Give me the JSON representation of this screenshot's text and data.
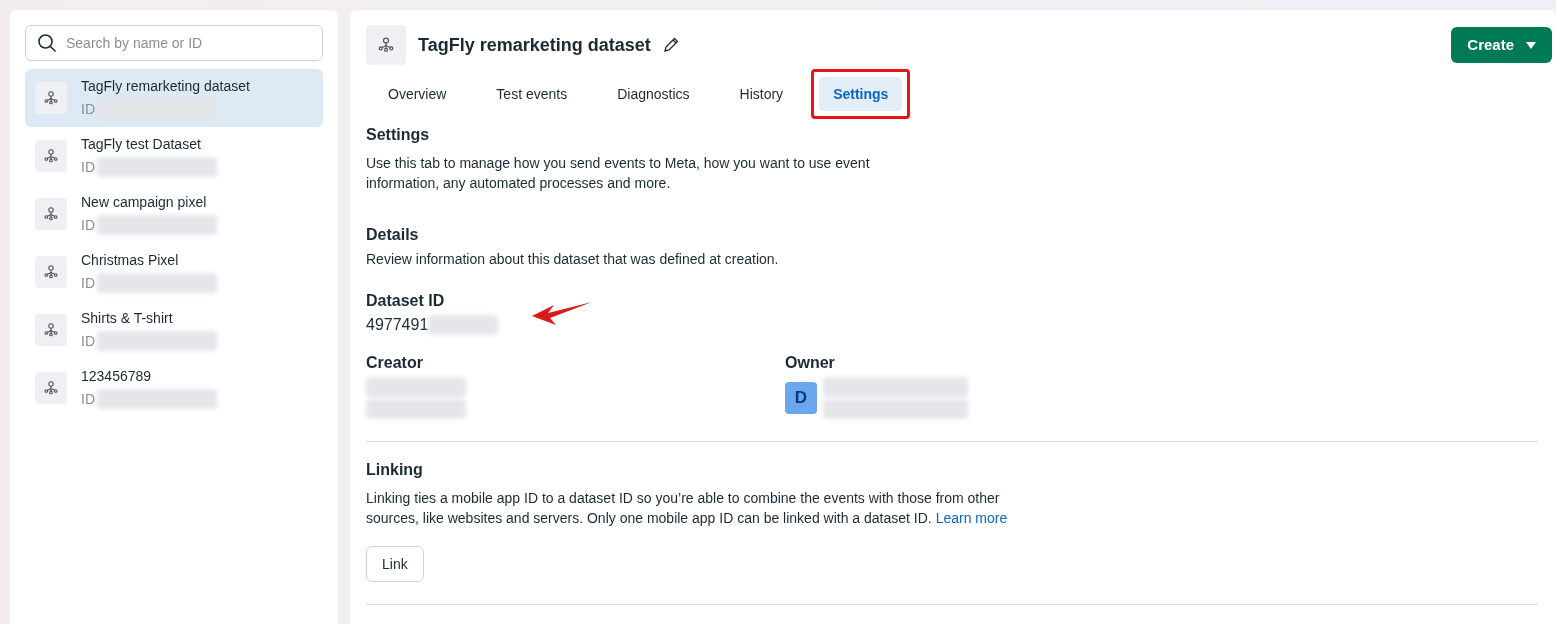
{
  "sidebar": {
    "search": {
      "placeholder": "Search by name or ID"
    },
    "items": [
      {
        "name": "TagFly remarketing dataset",
        "id_label": "ID",
        "selected": true
      },
      {
        "name": "TagFly test Dataset",
        "id_label": "ID",
        "selected": false
      },
      {
        "name": "New campaign pixel",
        "id_label": "ID",
        "selected": false
      },
      {
        "name": "Christmas Pixel",
        "id_label": "ID",
        "selected": false
      },
      {
        "name": "Shirts & T-shirt",
        "id_label": "ID",
        "selected": false
      },
      {
        "name": "123456789",
        "id_label": "ID",
        "selected": false
      }
    ]
  },
  "header": {
    "title": "TagFly remarketing dataset",
    "create_button": "Create"
  },
  "tabs": [
    {
      "label": "Overview",
      "selected": false,
      "highlighted": false
    },
    {
      "label": "Test events",
      "selected": false,
      "highlighted": false
    },
    {
      "label": "Diagnostics",
      "selected": false,
      "highlighted": false
    },
    {
      "label": "History",
      "selected": false,
      "highlighted": false
    },
    {
      "label": "Settings",
      "selected": true,
      "highlighted": true
    }
  ],
  "settings": {
    "heading": "Settings",
    "description": "Use this tab to manage how you send events to Meta, how you want to use event information, any automated processes and more."
  },
  "details": {
    "heading": "Details",
    "description": "Review information about this dataset that was defined at creation.",
    "dataset_id_label": "Dataset ID",
    "dataset_id": "4977491",
    "creator_label": "Creator",
    "owner_label": "Owner",
    "owner_avatar": "D"
  },
  "linking": {
    "heading": "Linking",
    "description": "Linking ties a mobile app ID to a dataset ID so you’re able to combine the events with those from other sources, like websites and servers. Only one mobile app ID can be linked with a dataset ID.",
    "link_text": "Learn more",
    "button": "Link"
  }
}
